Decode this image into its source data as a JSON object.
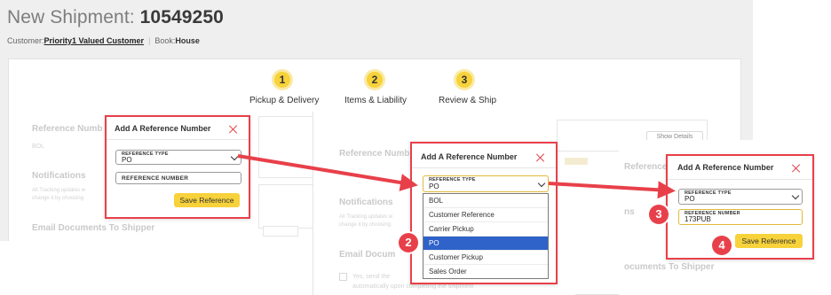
{
  "header": {
    "title_prefix": "New Shipment: ",
    "shipment_id": "10549250",
    "customer_label": "Customer:",
    "customer_name": "Priority1 Valued Customer",
    "separator": "|",
    "book_label": "Book:",
    "book_value": "House"
  },
  "stepper": {
    "steps": [
      {
        "number": "1",
        "label": "Pickup & Delivery"
      },
      {
        "number": "2",
        "label": "Items & Liability"
      },
      {
        "number": "3",
        "label": "Review & Ship"
      }
    ]
  },
  "background": {
    "reference_number_heading": "Reference Numb",
    "bol_text": "BOL",
    "notifications_heading": "Notifications",
    "notifications_text_1": "All Tracking updates w",
    "notifications_text_2": "change it by choosing",
    "email_docs_heading": "Email Documents To Shipper",
    "p2_reference_heading": "Reference Number",
    "p2_notifications_heading": "Notifications",
    "p2_notif_text_1": "All Tracking updates w",
    "p2_notif_text_2": "change it by choosing",
    "p2_email_heading": "Email Docum",
    "p2_checkbox_text_1": "Yes, send the",
    "p2_checkbox_text_2": "automatically upon completing the shipment",
    "show_details": "Show Details",
    "p3_reference_heading": "Reference Nu",
    "p3_notifications_heading": "ns",
    "p3_email_heading": "ocuments To Shipper"
  },
  "dialog1": {
    "title": "Add A Reference Number",
    "ref_type_label": "REFERENCE TYPE",
    "ref_type_value": "PO",
    "ref_number_placeholder": "REFERENCE NUMBER",
    "save_label": "Save Reference"
  },
  "dialog2": {
    "title": "Add A Reference Number",
    "ref_type_label": "REFERENCE TYPE",
    "ref_type_value": "PO",
    "options": [
      {
        "label": "BOL",
        "selected": false
      },
      {
        "label": "Customer Reference",
        "selected": false
      },
      {
        "label": "Carrier Pickup",
        "selected": false
      },
      {
        "label": "PO",
        "selected": true
      },
      {
        "label": "Customer Pickup",
        "selected": false
      },
      {
        "label": "Sales Order",
        "selected": false
      }
    ]
  },
  "dialog3": {
    "title": "Add A Reference Number",
    "ref_type_label": "REFERENCE TYPE",
    "ref_type_value": "PO",
    "ref_number_label": "REFERENCE NUMBER",
    "ref_number_value": "173PUB",
    "save_label": "Save Reference"
  },
  "annotations": {
    "badges": [
      "2",
      "3",
      "4"
    ],
    "arrow_color": "#e8404a"
  },
  "colors": {
    "accent_yellow": "#f7d23a",
    "highlight_red": "#e8404a",
    "selected_blue": "#2f63c9"
  }
}
